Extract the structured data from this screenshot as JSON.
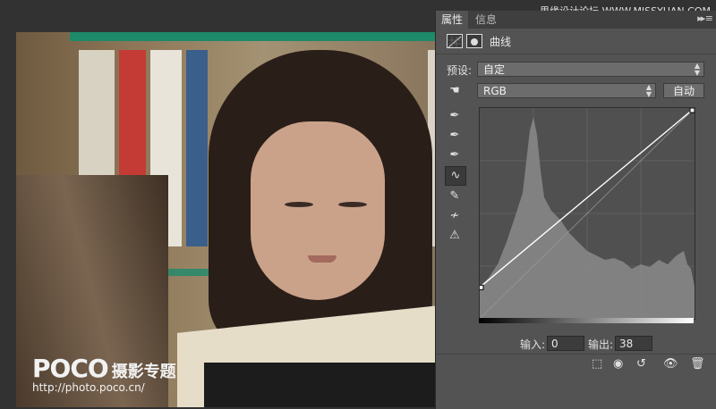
{
  "panel": {
    "tabs": [
      {
        "label": "属性",
        "active": true
      },
      {
        "label": "信息",
        "active": false
      }
    ],
    "menu_icon": "panel-menu-icon",
    "title": "曲线",
    "preset": {
      "label": "预设:",
      "value": "自定"
    },
    "channel": {
      "value": "RGB"
    },
    "auto_button": "自动",
    "input": {
      "label": "输入:",
      "value": "0"
    },
    "output": {
      "label": "输出:",
      "value": "38"
    },
    "tools": [
      "target-adjust-icon",
      "black-point-eyedropper-icon",
      "gray-point-eyedropper-icon",
      "white-point-eyedropper-icon",
      "curve-edit-icon",
      "pencil-draw-icon",
      "smooth-icon",
      "clipping-warning-icon"
    ],
    "bottom_icons": [
      "clip-to-layer-icon",
      "view-previous-icon",
      "reset-icon",
      "visibility-icon",
      "delete-icon"
    ]
  },
  "curve": {
    "points": [
      [
        0,
        38
      ],
      [
        255,
        255
      ]
    ],
    "range": [
      0,
      255
    ]
  },
  "watermark": {
    "logo": "POCO",
    "name": "摄影专题",
    "url": "http://photo.poco.cn/"
  },
  "site_watermark": "思缘设计论坛 WWW.MISSYUAN.COM",
  "colors": {
    "panel_bg": "#535353",
    "shelf": "#1d8a6a"
  }
}
